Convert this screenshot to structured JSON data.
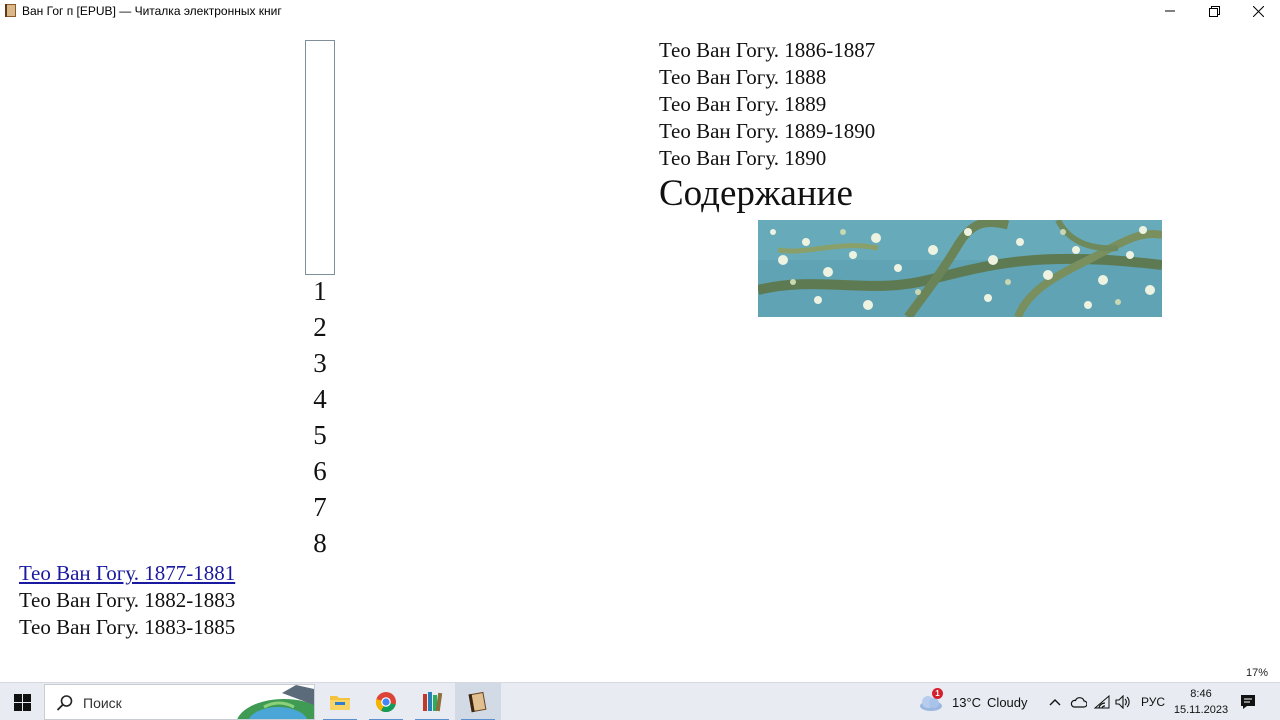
{
  "window": {
    "title": "Ван Гог п [EPUB] — Читалка электронных книг"
  },
  "reader": {
    "digits": [
      "1",
      "2",
      "3",
      "4",
      "5",
      "6",
      "7",
      "8"
    ],
    "toc_top": [
      "Тео Ван Гогу. 1886-1887",
      "Тео Ван Гогу. 1888",
      "Тео Ван Гогу. 1889",
      "Тео Ван Гогу. 1889-1890",
      "Тео Ван Гогу. 1890"
    ],
    "contents_heading": "Содержание",
    "toc_bottom": [
      {
        "label": "Тео Ван Гогу. 1877-1881",
        "link": true
      },
      {
        "label": "Тео Ван Гогу. 1882-1883",
        "link": false
      },
      {
        "label": "Тео Ван Гогу. 1883-1885",
        "link": false
      }
    ],
    "progress": "17%"
  },
  "taskbar": {
    "search_placeholder": "Поиск",
    "weather_temp": "13°C",
    "weather_condition": "Cloudy",
    "weather_badge": "1",
    "language": "РУС",
    "time": "8:46",
    "date": "15.11.2023",
    "apps": [
      "file-explorer-icon",
      "chrome-icon",
      "books-icon",
      "ebook-reader-icon"
    ]
  },
  "colors": {
    "link": "#1a1aa0",
    "taskbar": "#e8ecf2",
    "painting_sky": "#5a9fb0"
  }
}
